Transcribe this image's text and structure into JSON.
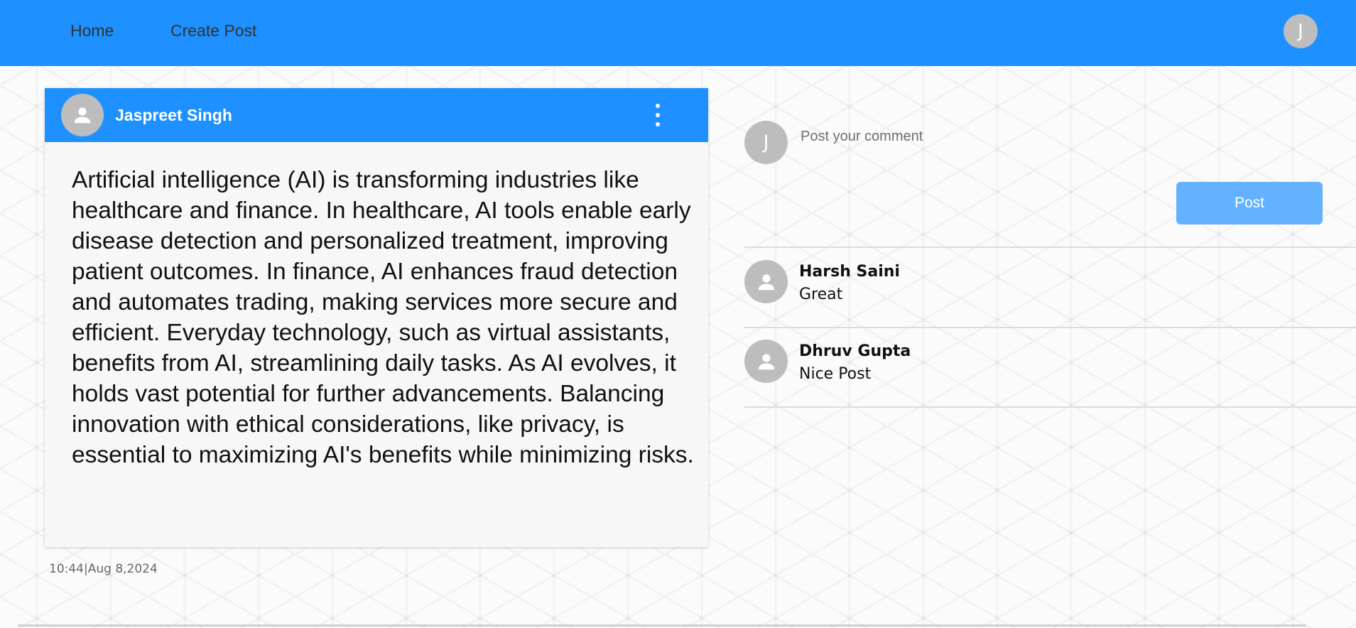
{
  "header": {
    "nav": {
      "home_label": "Home",
      "create_post_label": "Create Post"
    },
    "user_initial": "J",
    "bar_color": "#1e90ff"
  },
  "post": {
    "author": "Jaspreet Singh",
    "avatar_icon": "person-icon",
    "menu_icon": "more-vertical-icon",
    "body": "Artificial intelligence (AI) is transforming industries like healthcare and finance. In healthcare, AI tools enable early disease detection and personalized treatment, improving patient outcomes. In finance, AI enhances fraud detection and automates trading, making services more secure and efficient. Everyday technology, such as virtual assistants, benefits from AI, streamlining daily tasks. As AI evolves, it holds vast potential for further advancements. Balancing innovation with ethical considerations, like privacy, is essential to maximizing AI's benefits while minimizing risks.",
    "timestamp": "10:44|Aug 8,2024"
  },
  "comments_panel": {
    "my_initial": "J",
    "input_placeholder": "Post your comment",
    "post_button_label": "Post",
    "post_button_color": "#64b2ff",
    "comments": [
      {
        "author": "Harsh Saini",
        "text": "Great"
      },
      {
        "author": "Dhruv Gupta",
        "text": "Nice Post"
      }
    ]
  }
}
